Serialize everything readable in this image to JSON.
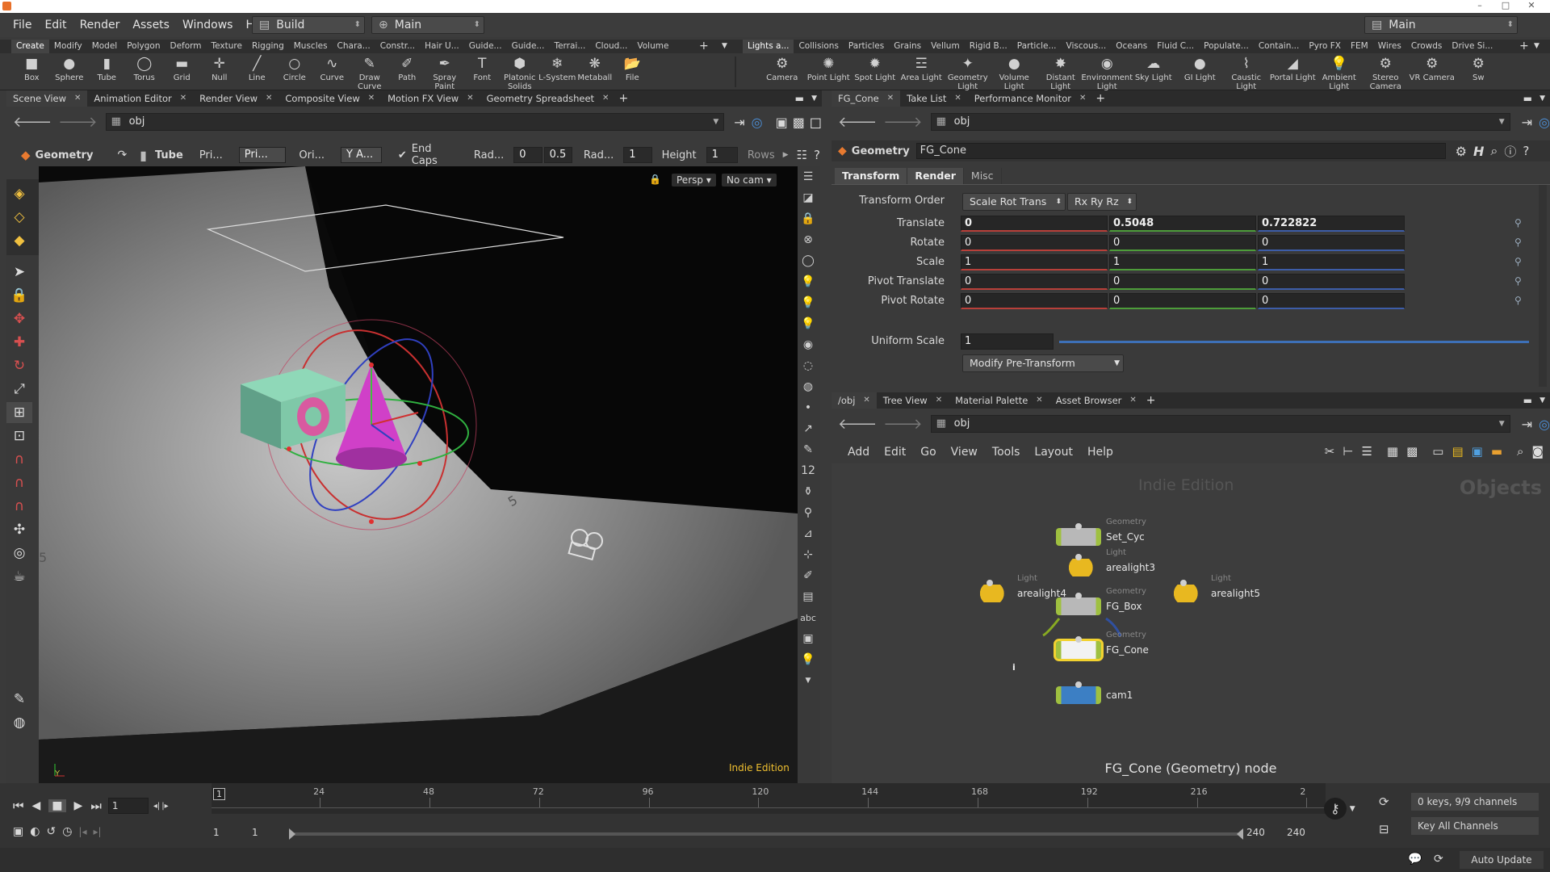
{
  "window": {
    "minimize": "–",
    "maximize": "□",
    "close": "✕"
  },
  "menubar": {
    "items": [
      "File",
      "Edit",
      "Render",
      "Assets",
      "Windows",
      "Help"
    ],
    "desktop": "Build",
    "network": "Main",
    "right_desktop": "Main"
  },
  "shelf_tabs_left": [
    "Create",
    "Modify",
    "Model",
    "Polygon",
    "Deform",
    "Texture",
    "Rigging",
    "Muscles",
    "Chara...",
    "Constr...",
    "Hair U...",
    "Guide...",
    "Guide...",
    "Terrai...",
    "Cloud...",
    "Volume"
  ],
  "shelf_tabs_right": [
    "Lights a...",
    "Collisions",
    "Particles",
    "Grains",
    "Vellum",
    "Rigid B...",
    "Particle...",
    "Viscous...",
    "Oceans",
    "Fluid C...",
    "Populate...",
    "Contain...",
    "Pyro FX",
    "FEM",
    "Wires",
    "Crowds",
    "Drive Si..."
  ],
  "shelf_tools_left": [
    {
      "label": "Box",
      "icon": "box-icon",
      "glyph": "■"
    },
    {
      "label": "Sphere",
      "icon": "sphere-icon",
      "glyph": "●"
    },
    {
      "label": "Tube",
      "icon": "tube-icon",
      "glyph": "▮"
    },
    {
      "label": "Torus",
      "icon": "torus-icon",
      "glyph": "◯"
    },
    {
      "label": "Grid",
      "icon": "grid-icon",
      "glyph": "▬"
    },
    {
      "label": "Null",
      "icon": "null-icon",
      "glyph": "✛"
    },
    {
      "label": "Line",
      "icon": "line-icon",
      "glyph": "╱"
    },
    {
      "label": "Circle",
      "icon": "circle-icon",
      "glyph": "○"
    },
    {
      "label": "Curve",
      "icon": "curve-icon",
      "glyph": "∿"
    },
    {
      "label": "Draw Curve",
      "icon": "draw-curve-icon",
      "glyph": "✎"
    },
    {
      "label": "Path",
      "icon": "path-icon",
      "glyph": "✐"
    },
    {
      "label": "Spray Paint",
      "icon": "spray-paint-icon",
      "glyph": "✒"
    },
    {
      "label": "Font",
      "icon": "font-icon",
      "glyph": "T"
    },
    {
      "label": "Platonic Solids",
      "icon": "platonic-icon",
      "glyph": "⬢"
    },
    {
      "label": "L-System",
      "icon": "lsystem-icon",
      "glyph": "❄"
    },
    {
      "label": "Metaball",
      "icon": "metaball-icon",
      "glyph": "❋"
    },
    {
      "label": "File",
      "icon": "file-icon",
      "glyph": "📂"
    }
  ],
  "shelf_tools_right": [
    {
      "label": "Camera",
      "icon": "camera-icon",
      "glyph": "⚙"
    },
    {
      "label": "Point Light",
      "icon": "point-light-icon",
      "glyph": "✺"
    },
    {
      "label": "Spot Light",
      "icon": "spot-light-icon",
      "glyph": "✹"
    },
    {
      "label": "Area Light",
      "icon": "area-light-icon",
      "glyph": "☲"
    },
    {
      "label": "Geometry Light",
      "icon": "geometry-light-icon",
      "glyph": "✦"
    },
    {
      "label": "Volume Light",
      "icon": "volume-light-icon",
      "glyph": "●"
    },
    {
      "label": "Distant Light",
      "icon": "distant-light-icon",
      "glyph": "✸"
    },
    {
      "label": "Environment Light",
      "icon": "environment-light-icon",
      "glyph": "◉"
    },
    {
      "label": "Sky Light",
      "icon": "sky-light-icon",
      "glyph": "☁"
    },
    {
      "label": "GI Light",
      "icon": "gi-light-icon",
      "glyph": "●"
    },
    {
      "label": "Caustic Light",
      "icon": "caustic-light-icon",
      "glyph": "⌇"
    },
    {
      "label": "Portal Light",
      "icon": "portal-light-icon",
      "glyph": "◢"
    },
    {
      "label": "Ambient Light",
      "icon": "ambient-light-icon",
      "glyph": "💡"
    },
    {
      "label": "Stereo Camera",
      "icon": "stereo-camera-icon",
      "glyph": "⚙"
    },
    {
      "label": "VR Camera",
      "icon": "vr-camera-icon",
      "glyph": "⚙"
    },
    {
      "label": "Sw",
      "icon": "switcher-icon",
      "glyph": "⚙"
    }
  ],
  "left_tabs": [
    "Scene View",
    "Animation Editor",
    "Render View",
    "Composite View",
    "Motion FX View",
    "Geometry Spreadsheet"
  ],
  "left_path": "obj",
  "opbar": {
    "context": "Geometry",
    "node": "Tube",
    "prim_label": "Pri...",
    "prim_value": "Pri...",
    "orient_label": "Ori...",
    "orient_value": "Y A...",
    "endcaps": "End Caps",
    "rad_label": "Rad...",
    "rad1": "0",
    "rad2": "0.5",
    "rad2_label": "Rad...",
    "rad3": "1",
    "height_label": "Height",
    "height": "1",
    "rows_label": "Rows"
  },
  "viewport": {
    "persp": "Persp",
    "cam": "No cam",
    "watermark": "Indie Edition",
    "grid_label": "5"
  },
  "right_top_tabs": [
    "FG_Cone",
    "Take List",
    "Performance Monitor"
  ],
  "right_top_path": "obj",
  "param": {
    "context": "Geometry",
    "name": "FG_Cone",
    "tabs": [
      "Transform",
      "Render",
      "Misc"
    ],
    "transform_order_label": "Transform Order",
    "transform_order": "Scale Rot Trans",
    "rot_order": "Rx Ry Rz",
    "rows": [
      {
        "label": "Translate",
        "x": "0",
        "y": "0.5048",
        "z": "0.722822"
      },
      {
        "label": "Rotate",
        "x": "0",
        "y": "0",
        "z": "0"
      },
      {
        "label": "Scale",
        "x": "1",
        "y": "1",
        "z": "1"
      },
      {
        "label": "Pivot Translate",
        "x": "0",
        "y": "0",
        "z": "0"
      },
      {
        "label": "Pivot Rotate",
        "x": "0",
        "y": "0",
        "z": "0"
      }
    ],
    "uniform_scale_label": "Uniform Scale",
    "uniform_scale": "1",
    "uniform_scale_fraction": 1.0,
    "pretransform": "Modify Pre-Transform"
  },
  "network_tabs": [
    "/obj",
    "Tree View",
    "Material Palette",
    "Asset Browser"
  ],
  "network_path": "obj",
  "network_menu": [
    "Add",
    "Edit",
    "Go",
    "View",
    "Tools",
    "Layout",
    "Help"
  ],
  "network": {
    "watermark": "Indie Edition",
    "context": "Objects",
    "nodes": [
      {
        "type": "Geometry",
        "name": "Set_Cyc",
        "kind": "geo"
      },
      {
        "type": "Light",
        "name": "arealight3",
        "kind": "light"
      },
      {
        "type": "Light",
        "name": "arealight4",
        "kind": "light"
      },
      {
        "type": "Light",
        "name": "arealight5",
        "kind": "light"
      },
      {
        "type": "Geometry",
        "name": "FG_Box",
        "kind": "geo"
      },
      {
        "type": "Geometry",
        "name": "FG_Cone",
        "kind": "geo-selected"
      },
      {
        "type": "",
        "name": "cam1",
        "kind": "cam"
      }
    ],
    "info_marker": "i",
    "status": "FG_Cone (Geometry) node"
  },
  "timeline": {
    "current_frame": "1",
    "frame_marker": "1",
    "ticks": [
      "24",
      "48",
      "72",
      "96",
      "120",
      "144",
      "168",
      "192",
      "216",
      "2"
    ],
    "start": "1",
    "range_start": "1",
    "range_end": "240",
    "end": "240",
    "keys_info": "0 keys, 9/9 channels",
    "key_all": "Key All Channels",
    "auto_update": "Auto Update"
  },
  "colors": {
    "x_axis": "#b8403a",
    "y_axis": "#4d9c3a",
    "z_axis": "#3d5da8",
    "selected_node": "#f2d230",
    "light_node": "#e8b820",
    "geo_node": "#b0b0b0",
    "cam_node": "#3c7fc4"
  }
}
